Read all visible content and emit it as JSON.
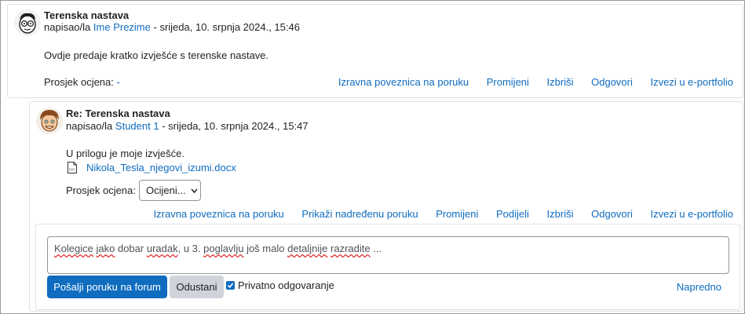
{
  "post1": {
    "subject": "Terenska nastava",
    "byline_prefix": "napisao/la",
    "author": "Ime Prezime",
    "date": "- srijeda, 10. srpnja 2024., 15:46",
    "message": "Ovdje predaje kratko izvješće s terenske nastave.",
    "rating_label": "Prosjek ocjena:",
    "rating_value": "-",
    "commands": [
      "Izravna poveznica na poruku",
      "Promijeni",
      "Izbriši",
      "Odgovori",
      "Izvezi u e-portfolio"
    ]
  },
  "post2": {
    "subject": "Re: Terenska nastava",
    "byline_prefix": "napisao/la",
    "author": "Student 1",
    "date": "- srijeda, 10. srpnja 2024., 15:47",
    "message": "U prilogu je moje izvješće.",
    "attachment": "Nikola_Tesla_njegovi_izumi.docx",
    "rating_label": "Prosjek ocjena:",
    "rating_value": "-",
    "rating_select": "Ocijeni...",
    "commands": [
      "Izravna poveznica na poruku",
      "Prikaži nadređenu poruku",
      "Promijeni",
      "Podijeli",
      "Izbriši",
      "Odgovori",
      "Izvezi u e-portfolio"
    ]
  },
  "reply": {
    "text_parts": [
      "Kolegice",
      " ",
      "jako",
      " dobar ",
      "uradak",
      ", u 3. ",
      "poglavlju",
      " još malo ",
      "detaljnije",
      " ",
      "razradite",
      " ..."
    ],
    "submit_label": "Pošalji poruku na forum",
    "cancel_label": "Odustani",
    "private_label": "Privatno odgovaranje",
    "private_checked": true,
    "advanced_label": "Napredno"
  },
  "colors": {
    "link": "#0f6cbf",
    "primary": "#0f6cbf",
    "secondary": "#ced4da"
  },
  "icons": {
    "avatar1": "cartoon-avatar-glasses",
    "avatar2": "cartoon-avatar-student",
    "attachment": "docx-file-icon",
    "select_arrow": "chevron-down-icon",
    "checkbox": "check-icon"
  }
}
